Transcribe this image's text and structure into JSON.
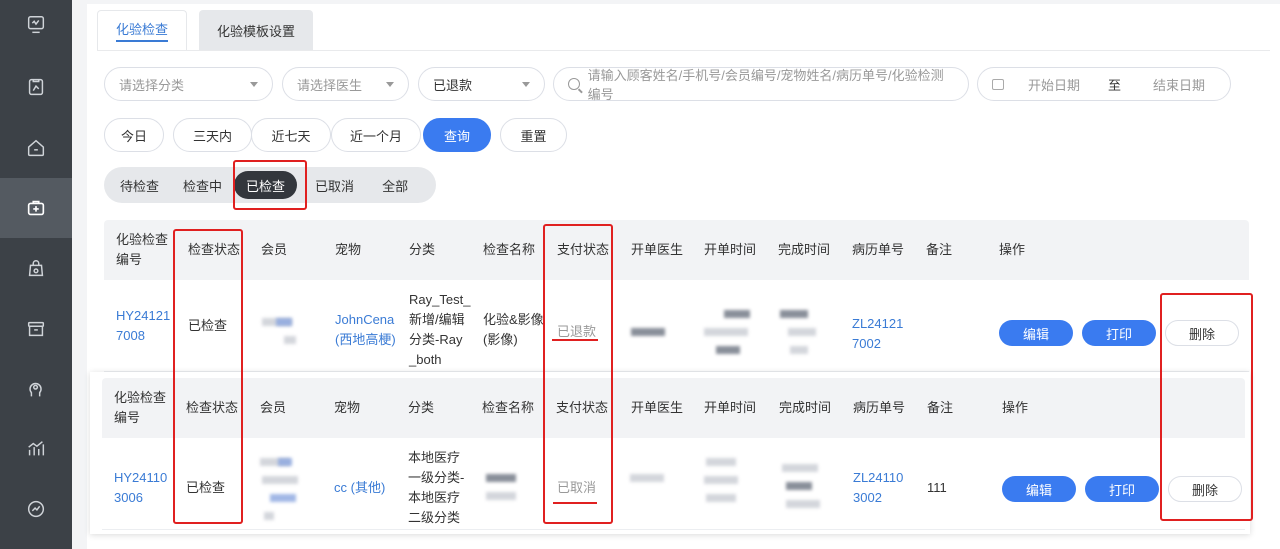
{
  "sidebar": {
    "icons": [
      "monitor-icon",
      "clipboard-chart-icon",
      "home-icon",
      "medical-kit-icon",
      "bag-icon",
      "box-icon",
      "head-icon",
      "growth-chart-icon",
      "trend-icon"
    ]
  },
  "tabs": [
    {
      "label": "化验检查",
      "active": true
    },
    {
      "label": "化验模板设置",
      "active": false
    }
  ],
  "filters": {
    "category_placeholder": "请选择分类",
    "doctor_placeholder": "请选择医生",
    "payment_status": "已退款",
    "search_placeholder": "请输入顾客姓名/手机号/会员编号/宠物姓名/病历单号/化验检测编号",
    "start_date": "开始日期",
    "date_sep": "至",
    "end_date": "结束日期"
  },
  "quick": {
    "today": "今日",
    "three_days": "三天内",
    "seven_days": "近七天",
    "month": "近一个月",
    "query": "查询",
    "reset": "重置"
  },
  "segments": [
    "待检查",
    "检查中",
    "已检查",
    "已取消",
    "全部"
  ],
  "columns": [
    "化验检查编号",
    "检查状态",
    "会员",
    "宠物",
    "分类",
    "检查名称",
    "支付状态",
    "开单医生",
    "开单时间",
    "完成时间",
    "病历单号",
    "备注",
    "操作"
  ],
  "rows": [
    {
      "id_line1": "HY24121",
      "id_line2": "7008",
      "status": "已检查",
      "pet_line1": "JohnCena",
      "pet_line2": "(西地高梗)",
      "category_lines": [
        "Ray_Test_",
        "新增/编辑",
        "分类-Ray",
        "_both"
      ],
      "check_name_line1": "化验&影像",
      "check_name_line2": "(影像)",
      "payment": "已退款",
      "record_line1": "ZL24121",
      "record_line2": "7002",
      "note": "",
      "edit": "编辑",
      "print": "打印",
      "delete": "删除"
    },
    {
      "id_line1": "HY24110",
      "id_line2": "3006",
      "status": "已检查",
      "pet_line1": "cc (其他)",
      "category_lines": [
        "本地医疗",
        "一级分类-",
        "本地医疗",
        "二级分类"
      ],
      "payment": "已取消",
      "record_line1": "ZL24110",
      "record_line2": "3002",
      "note": "111",
      "edit": "编辑",
      "print": "打印",
      "delete": "删除"
    }
  ],
  "colors": {
    "accent": "#3a7bf0",
    "annotation": "#e02020",
    "sidebar": "#3c4147"
  }
}
